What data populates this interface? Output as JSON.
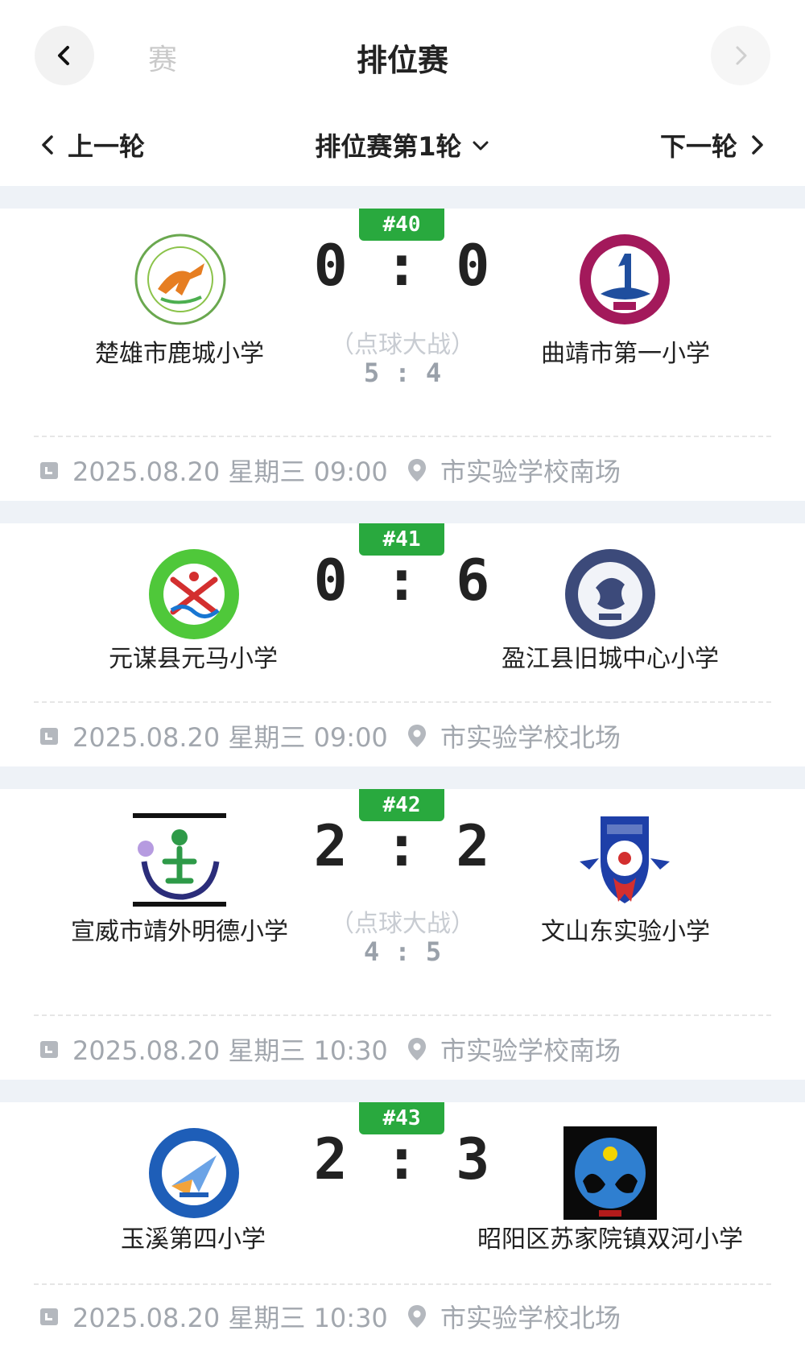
{
  "header": {
    "title": "排位赛",
    "prev_tab_partial": "赛"
  },
  "round_nav": {
    "prev_label": "上一轮",
    "current_label": "排位赛第1轮",
    "next_label": "下一轮"
  },
  "colors": {
    "badge_green": "#29a93e",
    "separator": "#eef2f7",
    "meta_gray": "#a2a7ae",
    "penalty_label": "#c8ccd2"
  },
  "matches": [
    {
      "number": "#40",
      "home": {
        "name": "楚雄市鹿城小学",
        "logo_icon": "deer-school-crest"
      },
      "away": {
        "name": "曲靖市第一小学",
        "logo_icon": "qujing-no1-crest"
      },
      "home_score": "0",
      "away_score": "0",
      "score_text": "0 : 0",
      "penalty_label": "（点球大战）",
      "penalty_score": "5 : 4",
      "datetime": "2025.08.20 星期三 09:00",
      "venue": "市实验学校南场"
    },
    {
      "number": "#41",
      "home": {
        "name": "元谋县元马小学",
        "logo_icon": "yuanma-crest"
      },
      "away": {
        "name": "盈江县旧城中心小学",
        "logo_icon": "dragon-crest"
      },
      "score_text": "0 : 6",
      "datetime": "2025.08.20 星期三 09:00",
      "venue": "市实验学校北场"
    },
    {
      "number": "#42",
      "home": {
        "name": "宣威市靖外明德小学",
        "logo_icon": "mingde-crest"
      },
      "away": {
        "name": "文山东实验小学",
        "logo_icon": "football-shield-crest"
      },
      "score_text": "2 : 2",
      "penalty_label": "（点球大战）",
      "penalty_score": "4 : 5",
      "datetime": "2025.08.20 星期三 10:30",
      "venue": "市实验学校南场"
    },
    {
      "number": "#43",
      "home": {
        "name": "玉溪第四小学",
        "logo_icon": "paper-plane-crest"
      },
      "away": {
        "name": "昭阳区苏家院镇双河小学",
        "logo_icon": "hands-crest"
      },
      "score_text": "2 : 3",
      "datetime": "2025.08.20 星期三 10:30",
      "venue": "市实验学校北场"
    }
  ]
}
